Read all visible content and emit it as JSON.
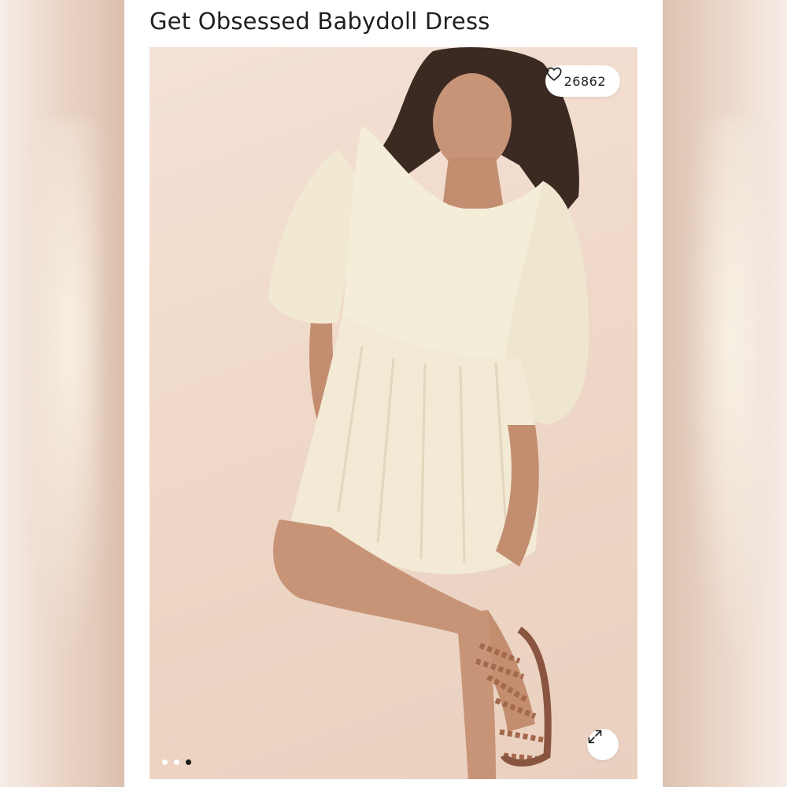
{
  "product": {
    "title": "Get Obsessed Babydoll Dress"
  },
  "gallery": {
    "likes_count": "26862",
    "like_icon": "heart-outline-icon",
    "expand_icon": "expand-arrows-icon",
    "slide_count": 3,
    "active_slide": 3
  },
  "colors": {
    "background": "#ffffff",
    "photo_wall": "#efd8c8",
    "dress": "#f3ecd8",
    "active_dot": "#1a1a1a"
  }
}
